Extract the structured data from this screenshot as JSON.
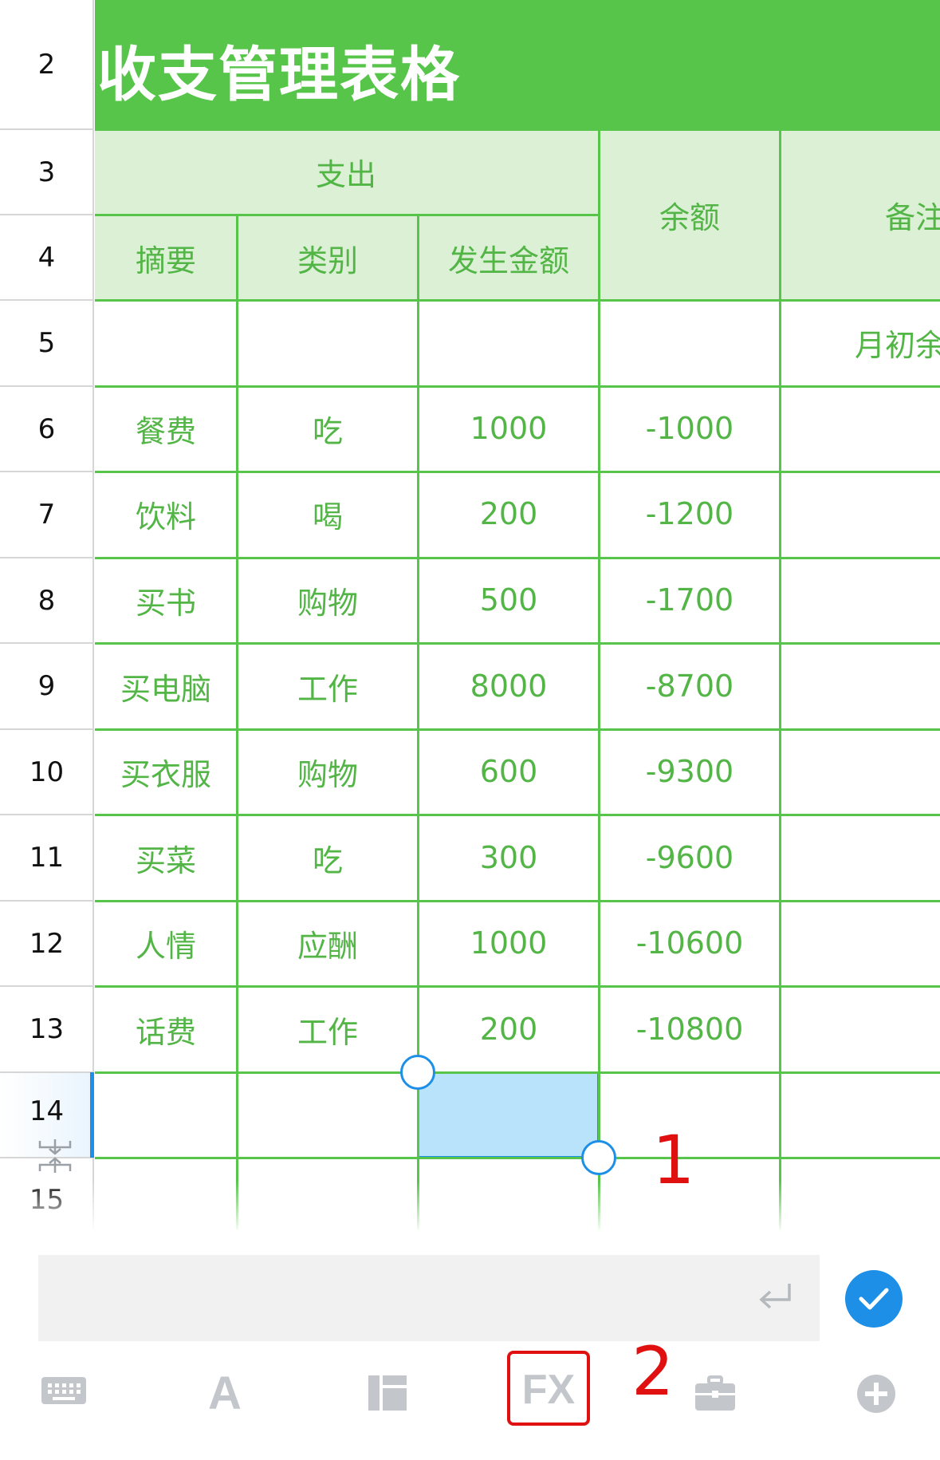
{
  "title": "收支管理表格",
  "row_numbers": [
    "2",
    "3",
    "4",
    "5",
    "6",
    "7",
    "8",
    "9",
    "10",
    "11",
    "12",
    "13",
    "14",
    "15"
  ],
  "header": {
    "group_expense": "支出",
    "col_summary": "摘要",
    "col_category": "类别",
    "col_amount": "发生金额",
    "col_balance": "余额",
    "col_note": "备注"
  },
  "row5_note": "月初余",
  "rows": [
    {
      "summary": "餐费",
      "category": "吃",
      "amount": "1000",
      "balance": "-1000"
    },
    {
      "summary": "饮料",
      "category": "喝",
      "amount": "200",
      "balance": "-1200"
    },
    {
      "summary": "买书",
      "category": "购物",
      "amount": "500",
      "balance": "-1700"
    },
    {
      "summary": "买电脑",
      "category": "工作",
      "amount": "8000",
      "balance": "-8700"
    },
    {
      "summary": "买衣服",
      "category": "购物",
      "amount": "600",
      "balance": "-9300"
    },
    {
      "summary": "买菜",
      "category": "吃",
      "amount": "300",
      "balance": "-9600"
    },
    {
      "summary": "人情",
      "category": "应酬",
      "amount": "1000",
      "balance": "-10600"
    },
    {
      "summary": "话费",
      "category": "工作",
      "amount": "200",
      "balance": "-10800"
    }
  ],
  "annotations": {
    "step1": "1",
    "step2": "2"
  },
  "input": {
    "value": ""
  },
  "toolbar": {
    "font_label": "A",
    "fx_label": "FX",
    "icons": [
      "keyboard-icon",
      "font-icon",
      "layout-icon",
      "fx-icon",
      "toolbox-icon",
      "add-icon"
    ]
  },
  "colors": {
    "brand_green": "#56c549",
    "header_fill": "#dcf0d6",
    "text_green": "#52b546",
    "selection_blue": "#1e8fe6",
    "annotation_red": "#e11010"
  }
}
